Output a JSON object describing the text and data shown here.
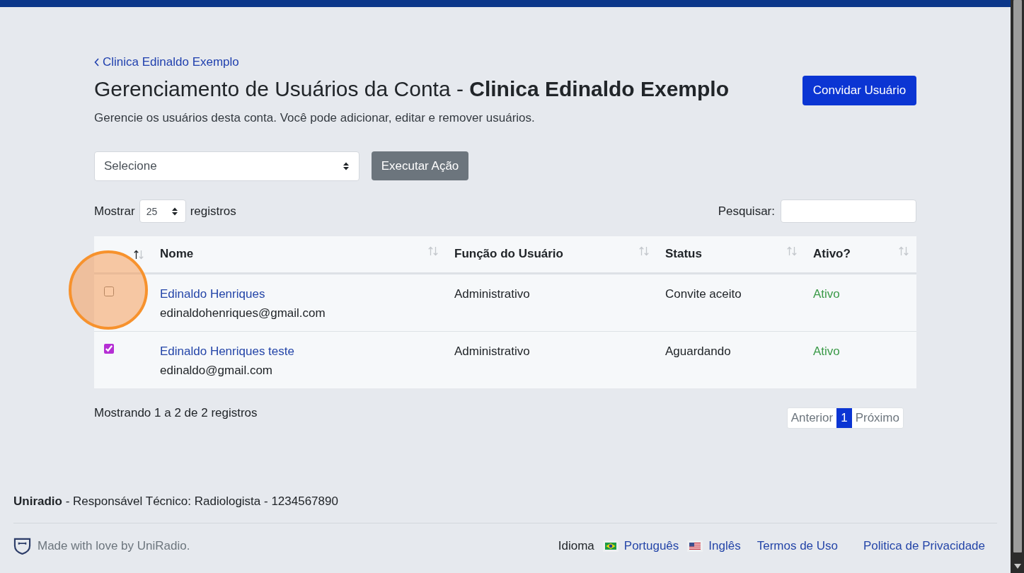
{
  "breadcrumb": {
    "label": "Clinica Edinaldo Exemplo"
  },
  "header": {
    "title": "Gerenciamento de Usuários da Conta - **Clinica Edinaldo Exemplo**",
    "description": "Gerencie os usuários desta conta. Você pode adicionar, editar e remover usuários.",
    "invite_button": "Convidar Usuário"
  },
  "bulk_actions": {
    "select_value": "Selecione",
    "button": "Executar Ação"
  },
  "length_menu": {
    "label_before": "Mostrar",
    "value": "25",
    "label_after": "registros"
  },
  "search": {
    "label": "Pesquisar:"
  },
  "table": {
    "columns": [
      {
        "kind": "select",
        "sorted": true
      },
      {
        "kind": "text",
        "label": "Nome",
        "sorted": false
      },
      {
        "kind": "text",
        "label": "Função do Usuário",
        "sorted": false
      },
      {
        "kind": "text",
        "label": "Status",
        "sorted": false
      },
      {
        "kind": "text",
        "label": "Ativo?",
        "sorted": false
      }
    ],
    "rows": [
      {
        "checked": false,
        "click_marker": true,
        "name": "Edinaldo Henriques",
        "email": "edinaldohenriques@gmail.com",
        "role": "Administrativo",
        "status": "Convite aceito",
        "active": {
          "label": "Ativo",
          "on": true
        }
      },
      {
        "checked": true,
        "click_marker": false,
        "name": "Edinaldo Henriques teste",
        "email": "edinaldo@gmail.com",
        "role": "Administrativo",
        "status": "Aguardando",
        "active": {
          "label": "Ativo",
          "on": true
        }
      }
    ]
  },
  "table_info": "Mostrando 1 a 2 de 2 registros",
  "pagination": {
    "previous": {
      "label": "Anterior",
      "disabled": true
    },
    "pages": [
      {
        "label": "1",
        "selected": true
      }
    ],
    "next": {
      "label": "Próximo",
      "disabled": true
    }
  },
  "footer": {
    "credit": "**Uniradio** - Responsável Técnico: Radiologista - 1234567890",
    "made_with": "Made with love by UniRadio.",
    "language_label": "Idioma",
    "languages": [
      {
        "label": "Português",
        "kind": "brazil"
      },
      {
        "label": "Inglês",
        "kind": "usa"
      }
    ],
    "links": [
      "Termos de Uso",
      "Politica de Privacidade"
    ]
  }
}
